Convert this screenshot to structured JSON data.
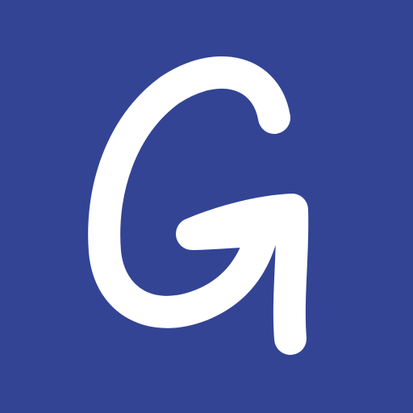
{
  "app_icon": {
    "logo_text": "G",
    "icon_name": "handwritten-g-logo-icon",
    "colors": {
      "background": "#334495",
      "glyph": "#FFFFFF"
    }
  }
}
